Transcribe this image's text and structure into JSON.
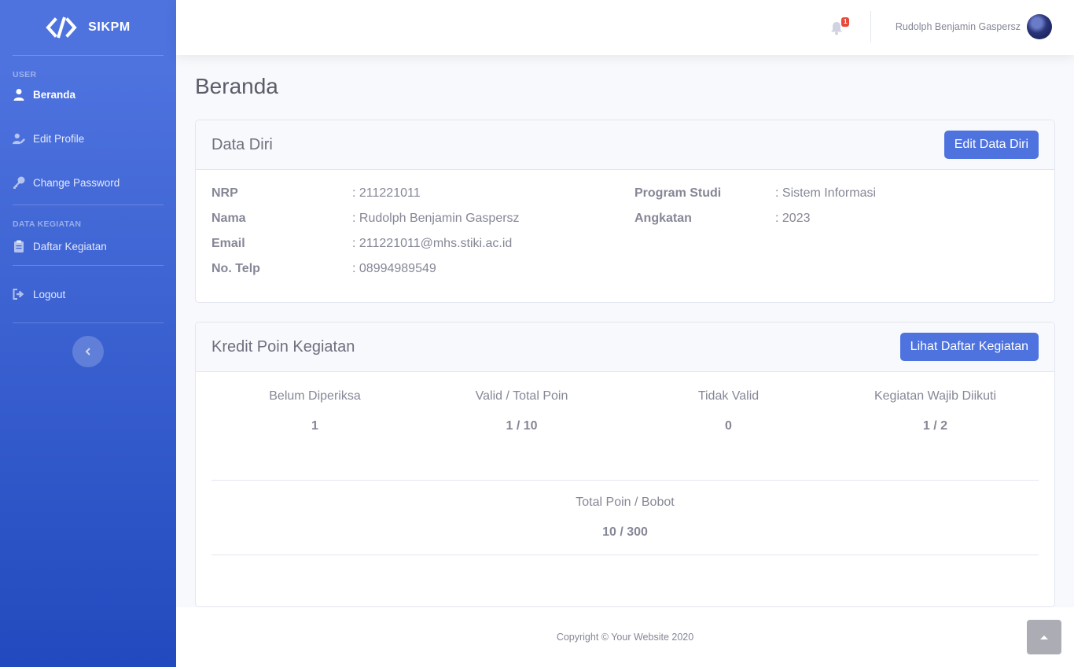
{
  "app": {
    "brand": "SIKPM"
  },
  "sidebar": {
    "section_user": "USER",
    "section_kegiatan": "DATA KEGIATAN",
    "items": [
      {
        "label": "Beranda",
        "icon": "user-icon",
        "active": true
      },
      {
        "label": "Edit Profile",
        "icon": "user-edit-icon"
      },
      {
        "label": "Change Password",
        "icon": "key-icon"
      },
      {
        "label": "Daftar Kegiatan",
        "icon": "clipboard-icon"
      },
      {
        "label": "Logout",
        "icon": "sign-out-icon"
      }
    ]
  },
  "topbar": {
    "notification_count": "1",
    "user_name": "Rudolph Benjamin Gaspersz"
  },
  "page": {
    "title": "Beranda"
  },
  "data_diri": {
    "title": "Data Diri",
    "button": "Edit Data Diri",
    "nrp_label": "NRP",
    "nrp_value": ": 211221011",
    "nama_label": "Nama",
    "nama_value": ": Rudolph Benjamin Gaspersz",
    "email_label": "Email",
    "email_value": ": 211221011@mhs.stiki.ac.id",
    "telp_label": "No. Telp",
    "telp_value": ": 08994989549",
    "prodi_label": "Program Studi",
    "prodi_value": ": Sistem Informasi",
    "angkatan_label": "Angkatan",
    "angkatan_value": ": 2023"
  },
  "kredit": {
    "title": "Kredit Poin Kegiatan",
    "button": "Lihat Daftar Kegiatan",
    "stats": [
      {
        "label": "Belum Diperiksa",
        "value": "1"
      },
      {
        "label": "Valid / Total Poin",
        "value": "1 / 10"
      },
      {
        "label": "Tidak Valid",
        "value": "0"
      },
      {
        "label": "Kegiatan Wajib Diikuti",
        "value": "1 / 2"
      }
    ],
    "total_label": "Total Poin / Bobot",
    "total_value": "10 / 300"
  },
  "footer": {
    "copyright": "Copyright © Your Website 2020"
  },
  "colors": {
    "primary": "#4e73df",
    "primary_dark": "#224abe",
    "danger": "#e74a3b",
    "text": "#858796"
  }
}
